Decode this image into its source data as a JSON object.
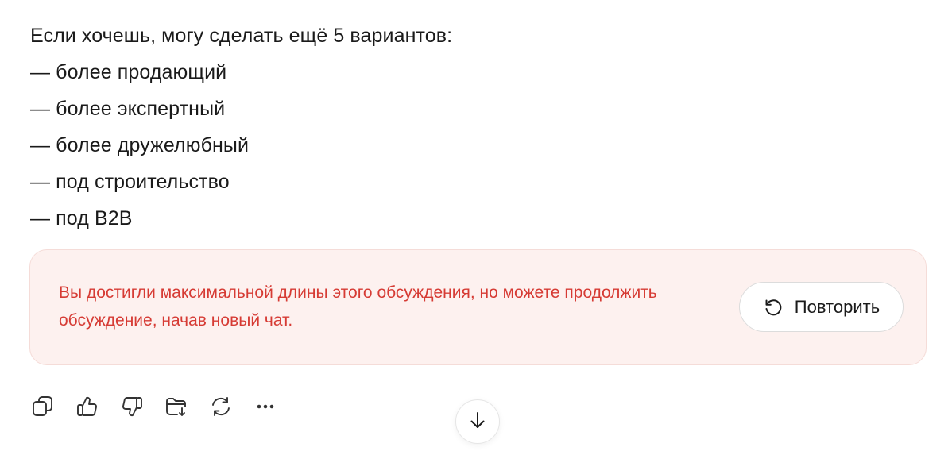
{
  "message": {
    "lines": [
      "Если хочешь, могу сделать ещё 5 вариантов:",
      "— более продающий",
      "— более экспертный",
      "— более дружелюбный",
      "— под строительство",
      "— под B2B"
    ]
  },
  "error_notice": {
    "text": "Вы достигли максимальной длины этого обсуждения, но можете продолжить обсуждение, начав новый чат.",
    "retry_label": "Повторить",
    "retry_icon": "retry-icon",
    "text_color": "#d63b34",
    "background_color": "#fdf1ef"
  },
  "actions": {
    "icons": [
      "copy-icon",
      "thumbs-up-icon",
      "thumbs-down-icon",
      "save-to-folder-icon",
      "regenerate-icon",
      "more-icon"
    ]
  },
  "scroll_down": {
    "icon": "arrow-down-icon"
  }
}
